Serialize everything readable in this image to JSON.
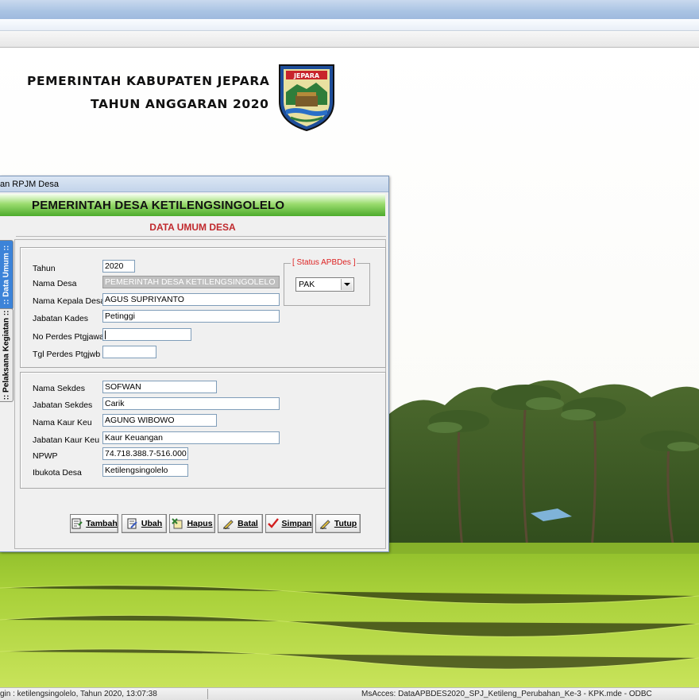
{
  "header": {
    "line1": "PEMERINTAH KABUPATEN JEPARA",
    "line2": "TAHUN ANGGARAN 2020",
    "logo_text": "JEPARA"
  },
  "form_window": {
    "caption": "an RPJM Desa",
    "banner": "PEMERINTAH DESA KETILENGSINGOLELO",
    "subtitle": "DATA UMUM DESA",
    "tabs": [
      {
        "label": ":: Data Umum ::",
        "active": true
      },
      {
        "label": ":: Pelaksana Kegiatan ::",
        "active": false
      }
    ],
    "fields": {
      "tahun": {
        "label": "Tahun",
        "value": "2020"
      },
      "nama_desa": {
        "label": "Nama Desa",
        "value": "PEMERINTAH DESA KETILENGSINGOLELO"
      },
      "nama_kepala_desa": {
        "label": "Nama Kepala Desa",
        "value": "AGUS SUPRIYANTO"
      },
      "jabatan_kades": {
        "label": "Jabatan Kades",
        "value": "Petinggi"
      },
      "no_perdes": {
        "label": "No Perdes Ptgjawab",
        "value": ""
      },
      "tgl_perdes": {
        "label": "Tgl Perdes Ptgjwb",
        "value": ""
      },
      "nama_sekdes": {
        "label": "Nama Sekdes",
        "value": "SOFWAN"
      },
      "jabatan_sekdes": {
        "label": "Jabatan Sekdes",
        "value": "Carik"
      },
      "nama_kaur_keu": {
        "label": "Nama Kaur Keu",
        "value": "AGUNG WIBOWO"
      },
      "jabatan_kaur_keu": {
        "label": "Jabatan Kaur Keu",
        "value": "Kaur Keuangan"
      },
      "npwp": {
        "label": "NPWP",
        "value": "74.718.388.7-516.000"
      },
      "ibukota_desa": {
        "label": "Ibukota Desa",
        "value": "Ketilengsingolelo"
      }
    },
    "status_apbdes": {
      "legend": "[ Status APBDes ]",
      "selected": "PAK"
    },
    "buttons": {
      "tambah": "Tambah",
      "ubah": "Ubah",
      "hapus": "Hapus",
      "batal": "Batal",
      "simpan": "Simpan",
      "tutup": "Tutup"
    },
    "colors": {
      "subtitle": "#c0292d",
      "active_tab": "#3c83d8",
      "legend": "#dd2222"
    }
  },
  "statusbar": {
    "left": "gin : ketilengsingolelo,  Tahun 2020, 13:07:38",
    "right": "MsAcces: DataAPBDES2020_SPJ_Ketileng_Perubahan_Ke-3 - KPK.mde - ODBC"
  }
}
